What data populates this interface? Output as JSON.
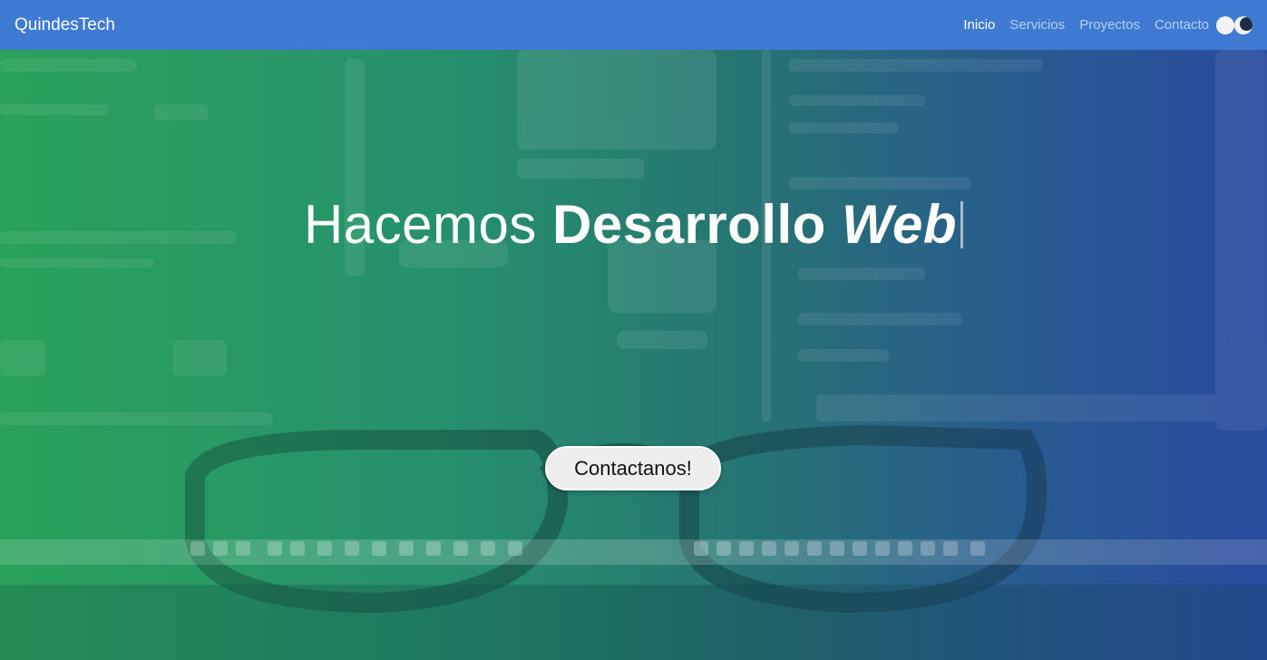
{
  "navbar": {
    "brand": "QuindesTech",
    "links": [
      {
        "label": "Inicio",
        "active": true
      },
      {
        "label": "Servicios",
        "active": false
      },
      {
        "label": "Proyectos",
        "active": false
      },
      {
        "label": "Contacto",
        "active": false
      }
    ],
    "theme_toggle": {
      "icons": [
        "sun-icon",
        "moon-icon"
      ]
    }
  },
  "hero": {
    "headline_prefix": "Hacemos",
    "headline_bold": "Desarrollo",
    "headline_italic": "Web",
    "cta_label": "Contactanos!"
  },
  "colors": {
    "navbar": "#3e7ad1",
    "gradient_left": "#2b9d5c",
    "gradient_right": "#2a4f97"
  }
}
